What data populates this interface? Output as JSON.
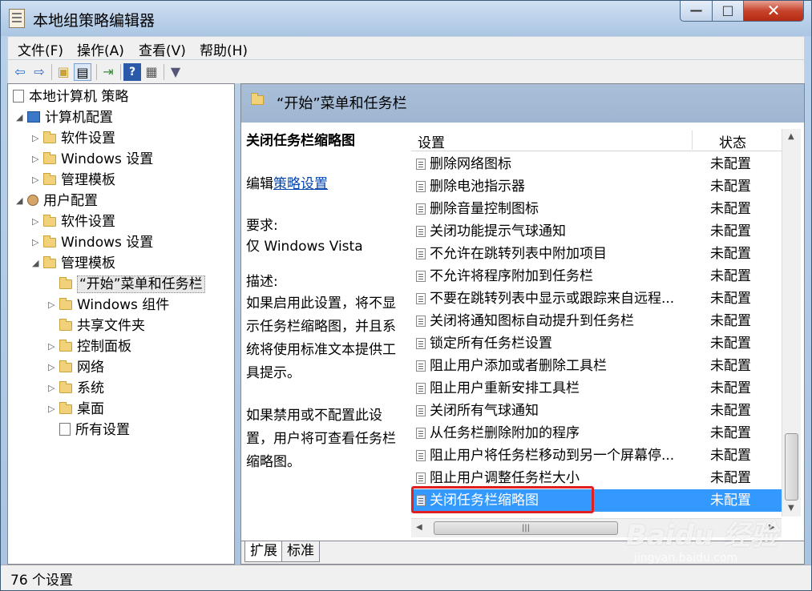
{
  "window": {
    "title": "本地组策略编辑器",
    "minimize": "—",
    "maximize": "□",
    "close": "✕"
  },
  "menu": [
    "文件(F)",
    "操作(A)",
    "查看(V)",
    "帮助(H)"
  ],
  "toolbar_icons": [
    "back-icon",
    "forward-icon",
    "up-folder-icon",
    "show-hide-tree-icon",
    "export-list-icon",
    "help-icon",
    "properties-icon",
    "filter-icon"
  ],
  "tree": {
    "root": "本地计算机 策略",
    "computer_config": "计算机配置",
    "cc_software": "软件设置",
    "cc_windows": "Windows 设置",
    "cc_admin": "管理模板",
    "user_config": "用户配置",
    "uc_software": "软件设置",
    "uc_windows": "Windows 设置",
    "uc_admin": "管理模板",
    "start_menu": "“开始”菜单和任务栏",
    "windows_components": "Windows 组件",
    "shared_folders": "共享文件夹",
    "control_panel": "控制面板",
    "network": "网络",
    "system": "系统",
    "desktop": "桌面",
    "all_settings": "所有设置"
  },
  "right_header": {
    "title": "“开始”菜单和任务栏"
  },
  "description": {
    "title": "关闭任务栏缩略图",
    "edit_prefix": "编辑",
    "edit_link": "策略设置",
    "req_label": "要求:",
    "req_value": "仅 Windows Vista",
    "desc_label": "描述:",
    "desc_line1": "如果启用此设置，将不显",
    "desc_line2": "示任务栏缩略图，并且系",
    "desc_line3": "统将使用标准文本提供工",
    "desc_line4": "具提示。",
    "desc_line5": "如果禁用或不配置此设",
    "desc_line6": "置，用户将可查看任务栏",
    "desc_line7": "缩略图。"
  },
  "list": {
    "col_setting": "设置",
    "col_state": "状态",
    "rows": [
      {
        "name": "删除网络图标",
        "state": "未配置"
      },
      {
        "name": "删除电池指示器",
        "state": "未配置"
      },
      {
        "name": "删除音量控制图标",
        "state": "未配置"
      },
      {
        "name": "关闭功能提示气球通知",
        "state": "未配置"
      },
      {
        "name": "不允许在跳转列表中附加项目",
        "state": "未配置"
      },
      {
        "name": "不允许将程序附加到任务栏",
        "state": "未配置"
      },
      {
        "name": "不要在跳转列表中显示或跟踪来自远程...",
        "state": "未配置"
      },
      {
        "name": "关闭将通知图标自动提升到任务栏",
        "state": "未配置"
      },
      {
        "name": "锁定所有任务栏设置",
        "state": "未配置"
      },
      {
        "name": "阻止用户添加或者删除工具栏",
        "state": "未配置"
      },
      {
        "name": "阻止用户重新安排工具栏",
        "state": "未配置"
      },
      {
        "name": "关闭所有气球通知",
        "state": "未配置"
      },
      {
        "name": "从任务栏删除附加的程序",
        "state": "未配置"
      },
      {
        "name": "阻止用户将任务栏移动到另一个屏幕停...",
        "state": "未配置"
      },
      {
        "name": "阻止用户调整任务栏大小",
        "state": "未配置"
      },
      {
        "name": "关闭任务栏缩略图",
        "state": "未配置"
      }
    ]
  },
  "tabs": [
    "扩展",
    "标准"
  ],
  "status": "76 个设置",
  "watermark": {
    "logo": "Baidu 经验",
    "url": "jingyan.baidu.com"
  },
  "colors": {
    "selection": "#3399ff",
    "highlight_box": "#e02020",
    "header": "#a9bfd8"
  }
}
